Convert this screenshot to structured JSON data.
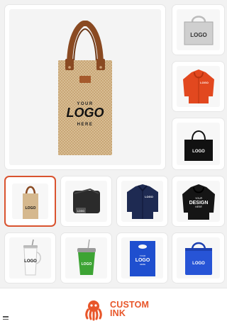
{
  "gallery": {
    "hero": {
      "name": "wine-tote-bag",
      "print_top": "YOUR",
      "print_logo": "LOGO",
      "print_bottom": "HERE"
    },
    "thumbs": [
      {
        "name": "silver-tote",
        "logo": "LOGO"
      },
      {
        "name": "orange-hoodie",
        "logo": "LOGO"
      },
      {
        "name": "black-tote",
        "logo": "LOGO"
      },
      {
        "name": "wine-tote-small",
        "logo": "LOGO",
        "selected": true
      },
      {
        "name": "black-blanket",
        "logo": "LOGO"
      },
      {
        "name": "navy-jacket",
        "logo": "LOGO"
      },
      {
        "name": "black-hoodie",
        "top": "YOUR",
        "logo": "DESIGN",
        "bottom": "HERE"
      },
      {
        "name": "white-tumbler",
        "logo": "LOGO"
      },
      {
        "name": "green-tumbler",
        "logo": "LOGO"
      },
      {
        "name": "blue-bag",
        "top": "YOUR",
        "logo": "LOGO",
        "bottom": "HERE"
      },
      {
        "name": "blue-cooler-bag",
        "logo": "LOGO"
      }
    ]
  },
  "footer": {
    "brand_line1": "CUSTOM",
    "brand_line2": "INK"
  },
  "colors": {
    "accent": "#e8562a",
    "selected_border": "#d9532f"
  }
}
